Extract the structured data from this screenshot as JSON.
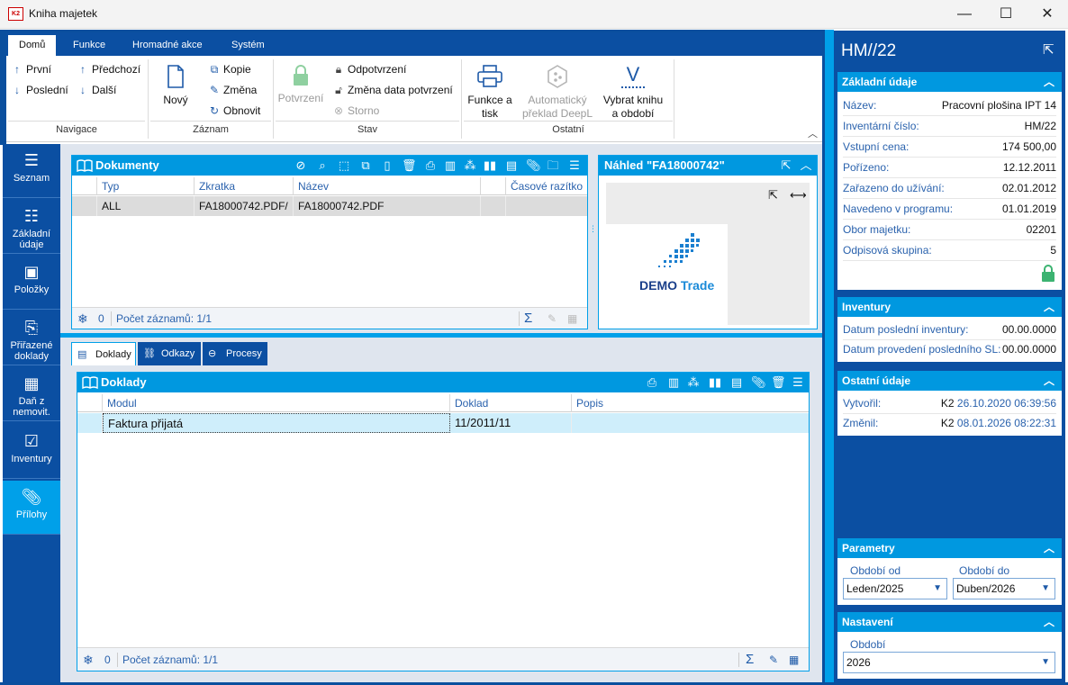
{
  "window": {
    "title": "Kniha majetek",
    "app_icon_text": "K2",
    "controls": {
      "minimize": "—",
      "maximize": "☐",
      "close": "✕"
    }
  },
  "ribbon": {
    "tabs": [
      "Domů",
      "Funkce",
      "Hromadné akce",
      "Systém"
    ],
    "navigace": {
      "label": "Navigace",
      "prvni": "První",
      "posledni": "Poslední",
      "predchozi": "Předchozí",
      "dalsi": "Další"
    },
    "zaznam": {
      "label": "Záznam",
      "novy": "Nový",
      "kopie": "Kopie",
      "zmena": "Změna",
      "obnovit": "Obnovit"
    },
    "stav": {
      "label": "Stav",
      "potvrzeni": "Potvrzení",
      "odpotvrzeni": "Odpotvrzení",
      "zmena_data": "Změna data potvrzení",
      "storno": "Storno"
    },
    "ostatni": {
      "label": "Ostatní",
      "funkce_line1": "Funkce a",
      "funkce_line2": "tisk",
      "preklad_line1": "Automatický",
      "preklad_line2": "překlad DeepL",
      "vybrat_line1": "Vybrat knihu",
      "vybrat_line2": "a období",
      "vybrat_icon": "V"
    }
  },
  "sidebar": {
    "items": [
      {
        "label1": "Seznam",
        "label2": ""
      },
      {
        "label1": "Základní",
        "label2": "údaje"
      },
      {
        "label1": "Položky",
        "label2": ""
      },
      {
        "label1": "Přiřazené",
        "label2": "doklady"
      },
      {
        "label1": "Daň z",
        "label2": "nemovit."
      },
      {
        "label1": "Inventury",
        "label2": ""
      },
      {
        "label1": "Přílohy",
        "label2": ""
      }
    ],
    "active_index": 6
  },
  "dokumenty": {
    "title": "Dokumenty",
    "columns": [
      "Typ",
      "Zkratka",
      "Název",
      "",
      "Časové razítko"
    ],
    "rows": [
      [
        "ALL",
        "FA18000742.PDF/",
        "FA18000742.PDF",
        "",
        ""
      ]
    ],
    "footer": {
      "count": "0",
      "records": "Počet záznamů: 1/1"
    }
  },
  "nahled": {
    "title": "Náhled  \"FA18000742\"",
    "logo_demo": "DEMO",
    "logo_trade": "Trade"
  },
  "subtabs": [
    "Doklady",
    "Odkazy",
    "Procesy"
  ],
  "doklady": {
    "title": "Doklady",
    "columns": [
      "Modul",
      "Doklad",
      "Popis"
    ],
    "rows": [
      [
        "Faktura přijatá",
        "11/2011/11",
        ""
      ]
    ],
    "footer": {
      "count": "0",
      "records": "Počet záznamů: 1/1"
    }
  },
  "right_panel": {
    "title": "HM//22",
    "zakladni": {
      "header": "Základní údaje",
      "fields": [
        {
          "label": "Název:",
          "value": "Pracovní plošina IPT 14"
        },
        {
          "label": "Inventární číslo:",
          "value": "HM/22"
        },
        {
          "label": "Vstupní cena:",
          "value": "174 500,00"
        },
        {
          "label": "Pořízeno:",
          "value": "12.12.2011"
        },
        {
          "label": "Zařazeno do užívání:",
          "value": "02.01.2012"
        },
        {
          "label": "Navedeno v programu:",
          "value": "01.01.2019"
        },
        {
          "label": "Obor majetku:",
          "value": "02201"
        },
        {
          "label": "Odpisová skupina:",
          "value": "5"
        }
      ]
    },
    "inventury": {
      "header": "Inventury",
      "fields": [
        {
          "label": "Datum poslední inventury:",
          "value": "00.00.0000"
        },
        {
          "label": "Datum provedení posledního SL:",
          "value": "00.00.0000"
        }
      ]
    },
    "ostatni": {
      "header": "Ostatní údaje",
      "vytvoril_label": "Vytvořil:",
      "vytvoril_user": "K2",
      "vytvoril_ts": "26.10.2020 06:39:56",
      "zmenil_label": "Změnil:",
      "zmenil_user": "K2",
      "zmenil_ts": "08.01.2026 08:22:31"
    },
    "parametry": {
      "header": "Parametry",
      "od_label": "Období od",
      "od_value": "Leden/2025",
      "do_label": "Období do",
      "do_value": "Duben/2026"
    },
    "nastaveni": {
      "header": "Nastavení",
      "obdobi_label": "Období",
      "obdobi_value": "2026"
    }
  },
  "colors": {
    "frame": "#0b4fa2",
    "accent": "#0098e0",
    "sidebar_active": "#00a0e9",
    "lock_green": "#3cb371"
  }
}
